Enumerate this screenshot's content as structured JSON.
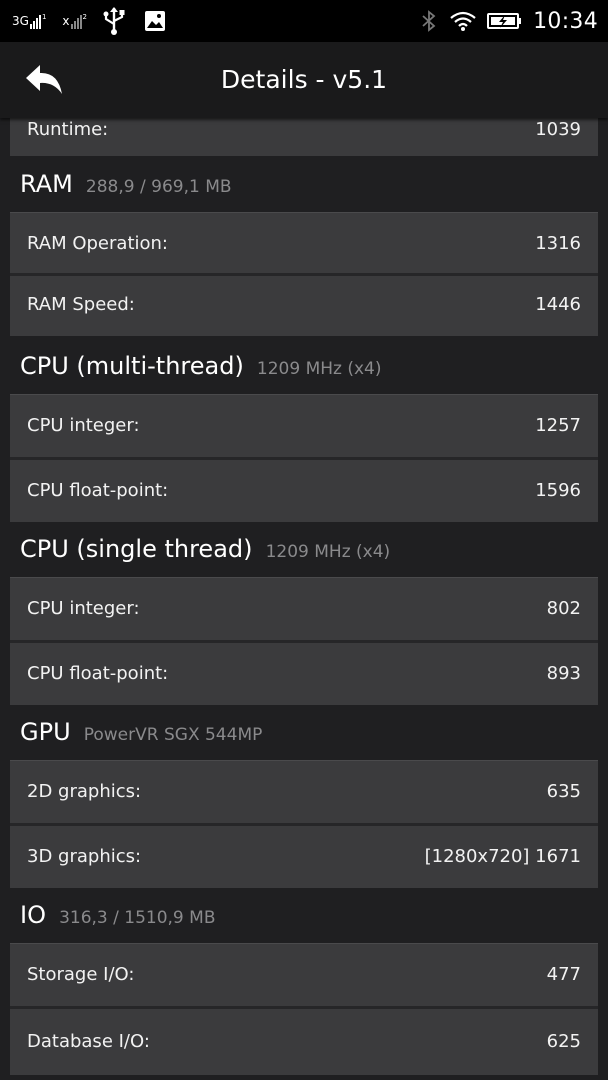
{
  "status": {
    "sim1": "3G",
    "sim1_index": "1",
    "sim2": "x",
    "sim2_index": "2",
    "time": "10:34"
  },
  "header": {
    "title": "Details - v5.1"
  },
  "top_row": {
    "label": "Runtime:",
    "value": "1039"
  },
  "sections": {
    "ram": {
      "title": "RAM",
      "info": "288,9 / 969,1 MB",
      "rows": [
        {
          "label": "RAM Operation:",
          "value": "1316"
        },
        {
          "label": "RAM Speed:",
          "value": "1446"
        }
      ]
    },
    "cpu_multi": {
      "title": "CPU (multi-thread)",
      "info": "1209 MHz (x4)",
      "rows": [
        {
          "label": "CPU integer:",
          "value": "1257"
        },
        {
          "label": "CPU float-point:",
          "value": "1596"
        }
      ]
    },
    "cpu_single": {
      "title": "CPU (single thread)",
      "info": "1209 MHz (x4)",
      "rows": [
        {
          "label": "CPU integer:",
          "value": "802"
        },
        {
          "label": "CPU float-point:",
          "value": "893"
        }
      ]
    },
    "gpu": {
      "title": "GPU",
      "info": "PowerVR SGX 544MP",
      "rows": [
        {
          "label": "2D graphics:",
          "value": "635"
        },
        {
          "label": "3D graphics:",
          "value": "[1280x720] 1671"
        }
      ]
    },
    "io": {
      "title": "IO",
      "info": "316,3 / 1510,9 MB",
      "rows": [
        {
          "label": "Storage I/O:",
          "value": "477"
        },
        {
          "label": "Database I/O:",
          "value": "625"
        }
      ]
    }
  }
}
